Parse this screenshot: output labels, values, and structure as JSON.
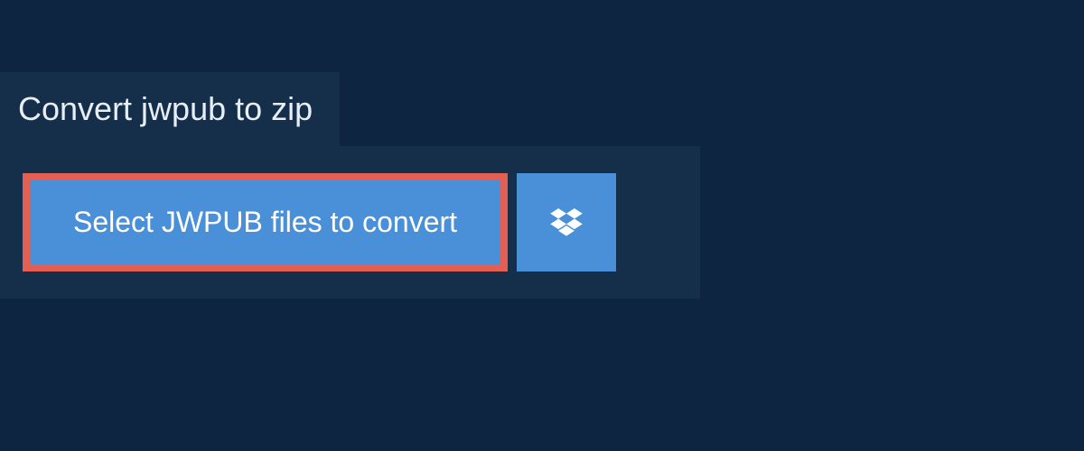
{
  "tab": {
    "title": "Convert jwpub to zip"
  },
  "panel": {
    "select_button_label": "Select JWPUB files to convert"
  },
  "colors": {
    "background": "#0d2540",
    "panel": "#152f4a",
    "button": "#4a90d9",
    "highlight_border": "#e35f53"
  }
}
